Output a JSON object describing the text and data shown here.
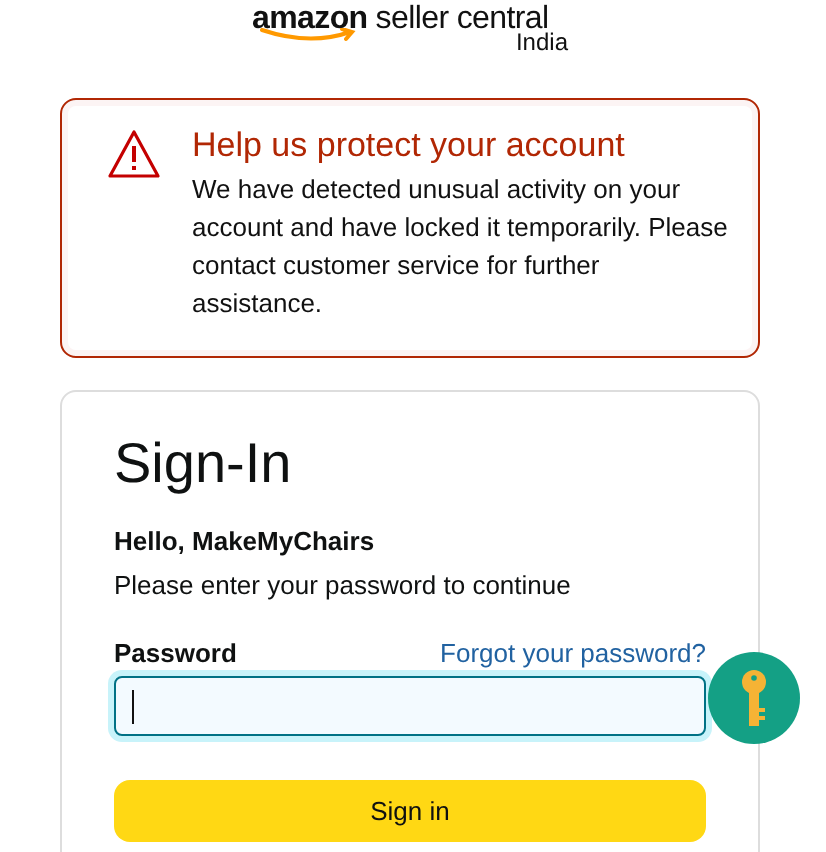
{
  "logo": {
    "brand": "amazon",
    "product": "seller central",
    "region": "India"
  },
  "alert": {
    "title": "Help us protect your account",
    "message": "We have detected unusual activity on your account and have locked it temporarily. Please contact customer service for further assistance."
  },
  "signin": {
    "heading": "Sign-In",
    "greeting": "Hello, MakeMyChairs",
    "instruction": "Please enter your password to continue",
    "password_label": "Password",
    "forgot_link": "Forgot your password?",
    "submit": "Sign in"
  }
}
